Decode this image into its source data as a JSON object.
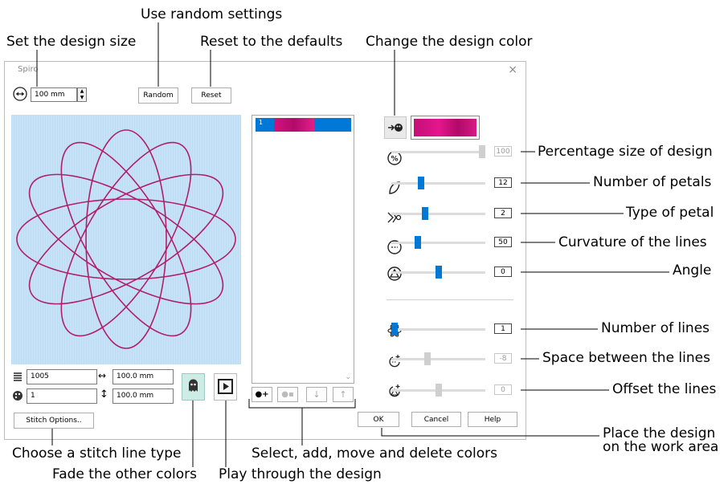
{
  "callouts": {
    "use_random": "Use random settings",
    "set_size": "Set the design size",
    "reset_defaults": "Reset to the defaults",
    "change_color": "Change the design color",
    "percentage": "Percentage size of design",
    "petals": "Number of petals",
    "petal_type": "Type of petal",
    "curvature": "Curvature of the lines",
    "angle": "Angle",
    "num_lines": "Number of lines",
    "space_lines": "Space between the lines",
    "offset_lines": "Offset the lines",
    "place_design_1": "Place the design",
    "place_design_2": "on the work area",
    "stitch_type": "Choose a stitch line type",
    "colors_ops": "Select, add, move and delete colors",
    "fade": "Fade the other colors",
    "play": "Play through the design"
  },
  "dialog": {
    "title": "Spiro",
    "close": "×",
    "size_value": "100 mm",
    "random_label": "Random",
    "reset_label": "Reset",
    "stitches_value": "1005",
    "colors_value": "1",
    "width_value": "100.0 mm",
    "height_value": "100.0 mm",
    "stitch_options_label": "Stitch Options..",
    "ok_label": "OK",
    "cancel_label": "Cancel",
    "help_label": "Help",
    "color_list": [
      {
        "index": "1",
        "color": "#d3127f"
      }
    ],
    "accent": "#0078d7",
    "thread_color": "#d3127f",
    "preview_bg": "#c6e2f7",
    "design_line_color": "#b0206a"
  },
  "sliders": {
    "percentage": {
      "value": "100",
      "level": 1.0,
      "enabled": false
    },
    "petals": {
      "value": "12",
      "level": 0.3,
      "enabled": true
    },
    "petal_type": {
      "value": "2",
      "level": 0.35,
      "enabled": true
    },
    "curvature": {
      "value": "50",
      "level": 0.27,
      "enabled": true
    },
    "angle": {
      "value": "0",
      "level": 0.5,
      "enabled": true
    },
    "num_lines": {
      "value": "1",
      "level": 0.0,
      "enabled": true
    },
    "space_lines": {
      "value": "-8",
      "level": 0.38,
      "enabled": false
    },
    "offset_lines": {
      "value": "0",
      "level": 0.5,
      "enabled": false
    }
  },
  "icons": {
    "size_arrows": "horizontal-arrows-icon",
    "stitches": "stitch-count-icon",
    "colors": "color-palette-icon",
    "width": "width-arrow-icon",
    "height": "height-arrow-icon",
    "fade": "ghost-icon",
    "play": "play-icon",
    "add_color": "add-color-icon",
    "delete_color": "delete-color-icon",
    "move_down": "arrow-down-icon",
    "move_up": "arrow-up-icon",
    "change_color": "change-color-icon"
  }
}
